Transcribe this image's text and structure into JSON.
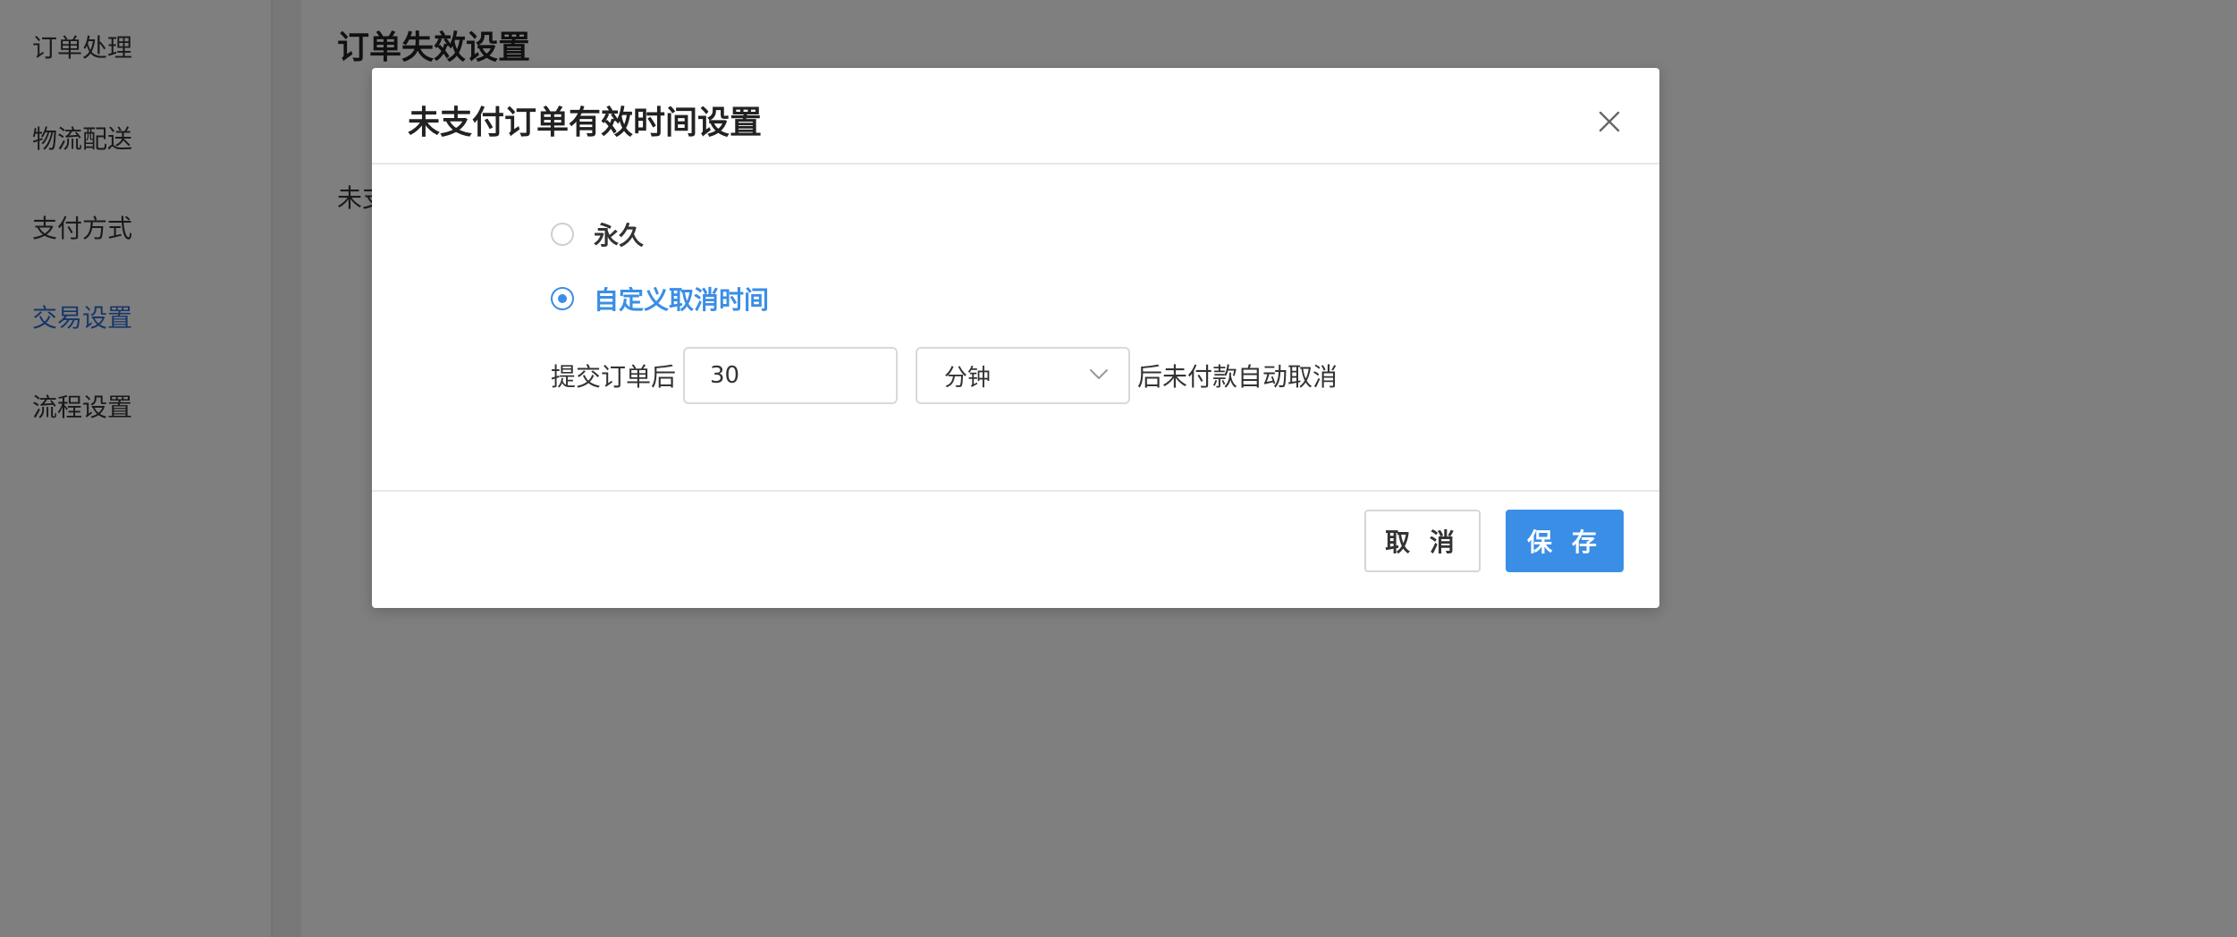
{
  "sidebar": {
    "items": [
      {
        "label": "订单处理"
      },
      {
        "label": "物流配送"
      },
      {
        "label": "支付方式"
      },
      {
        "label": "交易设置",
        "active": true
      },
      {
        "label": "流程设置"
      }
    ]
  },
  "main": {
    "title": "订单失效设置",
    "row_label_partial": "未支"
  },
  "dialog": {
    "title": "未支付订单有效时间设置",
    "options": [
      {
        "label": "永久",
        "checked": false
      },
      {
        "label": "自定义取消时间",
        "checked": true
      }
    ],
    "prefix_text": "提交订单后",
    "time_value": "30",
    "unit_selected": "分钟",
    "suffix_text": "后未付款自动取消",
    "cancel_label": "取 消",
    "save_label": "保 存"
  },
  "colors": {
    "accent": "#3a8ee6",
    "sidebar_active": "#2e6dd1",
    "overlay": "rgba(0,0,0,0.5)"
  }
}
